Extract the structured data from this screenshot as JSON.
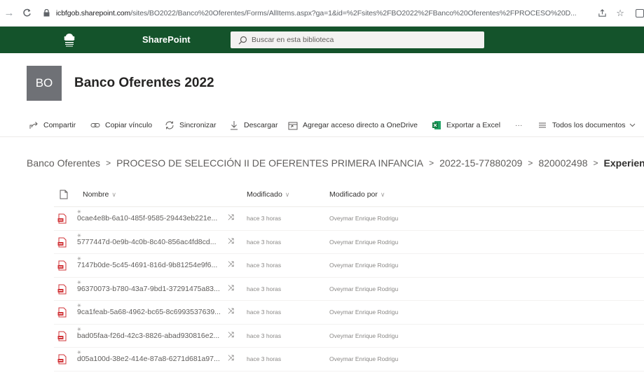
{
  "browser": {
    "url_host": "icbfgob.sharepoint.com",
    "url_rest": "/sites/BO2022/Banco%20Oferentes/Forms/AllItems.aspx?ga=1&id=%2Fsites%2FBO2022%2FBanco%20Oferentes%2FPROCESO%20D..."
  },
  "suite": {
    "app_name": "SharePoint",
    "search_placeholder": "Buscar en esta biblioteca"
  },
  "site": {
    "logo_text": "BO",
    "title": "Banco Oferentes 2022"
  },
  "commands": {
    "share": "Compartir",
    "copy_link": "Copiar vínculo",
    "sync": "Sincronizar",
    "download": "Descargar",
    "shortcut": "Agregar acceso directo a OneDrive",
    "export": "Exportar a Excel",
    "more": "···",
    "view": "Todos los documentos"
  },
  "breadcrumb": {
    "items": [
      "Banco Oferentes",
      "PROCESO DE SELECCIÓN II DE OFERENTES PRIMERA INFANCIA",
      "2022-15-77880209",
      "820002498"
    ],
    "current": "Experiencia",
    "separator": ">"
  },
  "list": {
    "columns": {
      "name": "Nombre",
      "modified": "Modificado",
      "modified_by": "Modificado por"
    },
    "rows": [
      {
        "name": "0cae4e8b-6a10-485f-9585-29443eb221e...",
        "modified": "hace 3 horas",
        "modified_by": "Oveymar Enrique Rodrigu"
      },
      {
        "name": "5777447d-0e9b-4c0b-8c40-856ac4fd8cd...",
        "modified": "hace 3 horas",
        "modified_by": "Oveymar Enrique Rodrigu"
      },
      {
        "name": "7147b0de-5c45-4691-816d-9b81254e9f6...",
        "modified": "hace 3 horas",
        "modified_by": "Oveymar Enrique Rodrigu"
      },
      {
        "name": "96370073-b780-43a7-9bd1-37291475a83...",
        "modified": "hace 3 horas",
        "modified_by": "Oveymar Enrique Rodrigu"
      },
      {
        "name": "9ca1feab-5a68-4962-bc65-8c6993537639...",
        "modified": "hace 3 horas",
        "modified_by": "Oveymar Enrique Rodrigu"
      },
      {
        "name": "bad05faa-f26d-42c3-8826-abad930816e2...",
        "modified": "hace 3 horas",
        "modified_by": "Oveymar Enrique Rodrigu"
      },
      {
        "name": "d05a100d-38e2-414e-87a8-6271d681a97...",
        "modified": "hace 3 horas",
        "modified_by": "Oveymar Enrique Rodrigu"
      }
    ]
  },
  "colors": {
    "suite_bar": "#14532b",
    "site_logo_bg": "#6f7176",
    "pdf_red": "#d13438",
    "excel_green": "#107c41"
  }
}
